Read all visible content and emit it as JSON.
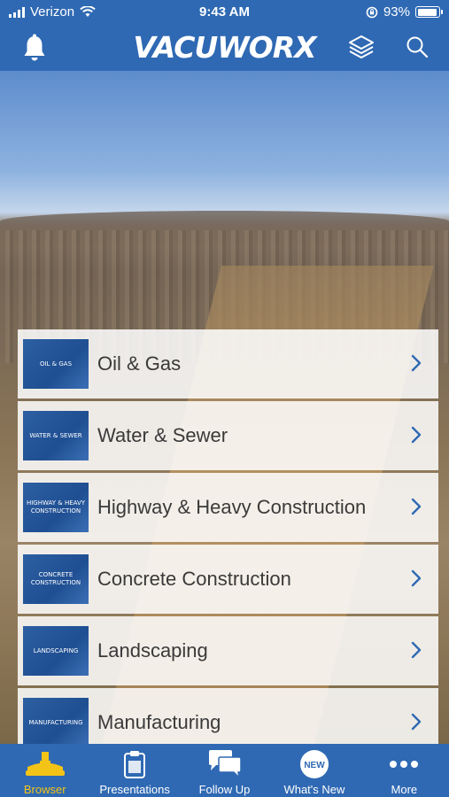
{
  "status_bar": {
    "carrier": "Verizon",
    "time": "9:43 AM",
    "battery": "93%",
    "battery_level": 0.93
  },
  "header": {
    "logo": "VACUWORX",
    "icons": [
      "bell-icon",
      "layers-icon",
      "search-icon"
    ]
  },
  "categories": [
    {
      "label": "Oil & Gas",
      "thumb": "OIL & GAS"
    },
    {
      "label": "Water & Sewer",
      "thumb": "WATER & SEWER"
    },
    {
      "label": "Highway & Heavy Construction",
      "thumb": "HIGHWAY & HEAVY CONSTRUCTION"
    },
    {
      "label": "Concrete Construction",
      "thumb": "CONCRETE CONSTRUCTION"
    },
    {
      "label": "Landscaping",
      "thumb": "LANDSCAPING"
    },
    {
      "label": "Manufacturing",
      "thumb": "MANUFACTURING"
    }
  ],
  "tabbar": {
    "tabs": [
      {
        "label": "Browser",
        "icon": "lifter-icon",
        "active": true
      },
      {
        "label": "Presentations",
        "icon": "clipboard-icon",
        "active": false
      },
      {
        "label": "Follow Up",
        "icon": "chat-bubbles-icon",
        "active": false
      },
      {
        "label": "What's New",
        "icon": "new-badge-icon",
        "badge": "NEW",
        "active": false
      },
      {
        "label": "More",
        "icon": "more-dots-icon",
        "active": false
      }
    ]
  },
  "colors": {
    "primary": "#2f69b3",
    "active_tab": "#f3c317"
  }
}
